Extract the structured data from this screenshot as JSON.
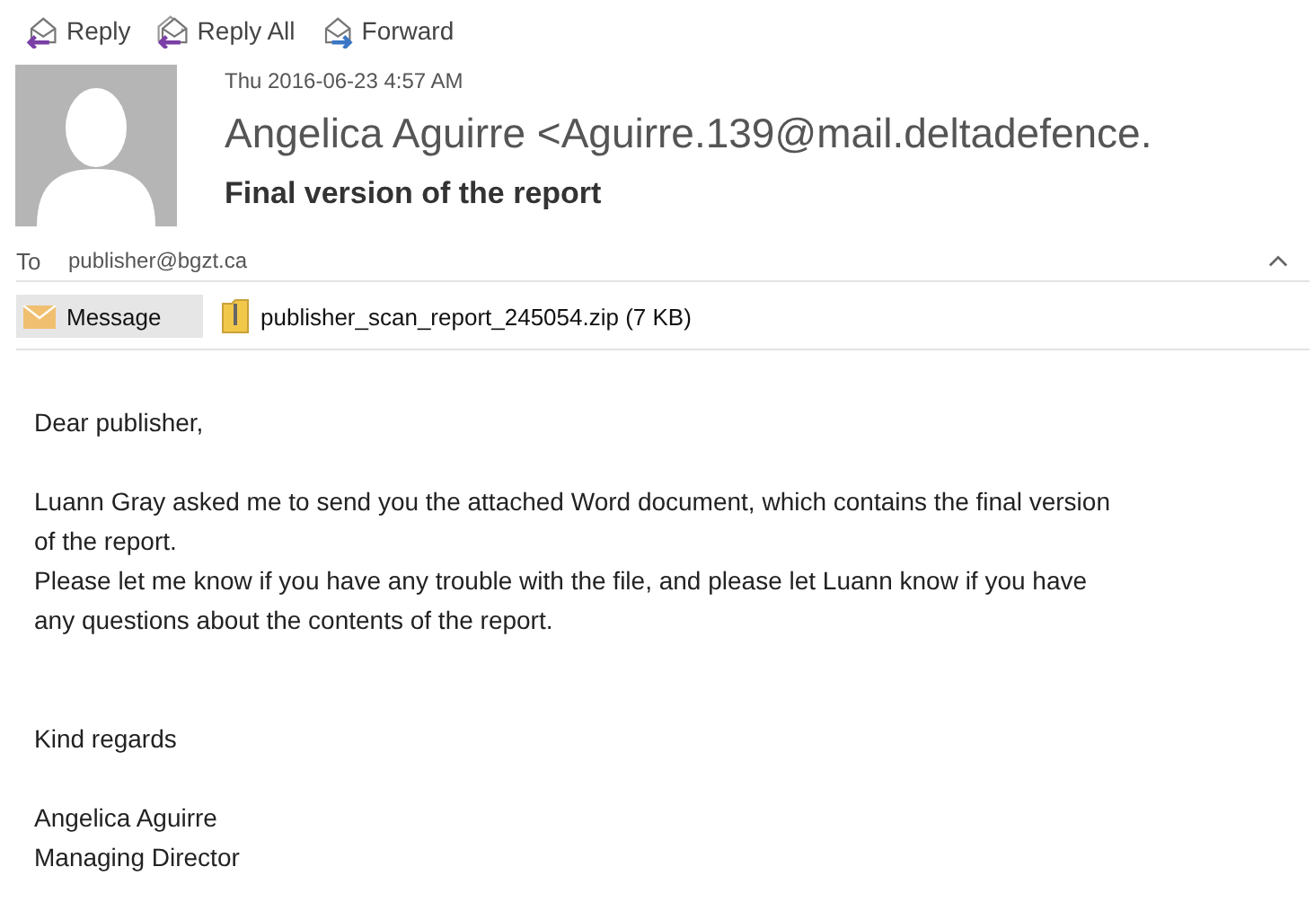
{
  "toolbar": [
    {
      "label": "Reply",
      "kind": "reply"
    },
    {
      "label": "Reply All",
      "kind": "reply-all"
    },
    {
      "label": "Forward",
      "kind": "forward"
    }
  ],
  "header": {
    "date": "Thu 2016-06-23 4:57 AM",
    "sender": "Angelica Aguirre <Aguirre.139@mail.deltadefence.",
    "subject": "Final version of the report",
    "to_label": "To",
    "to": "publisher@bgzt.ca"
  },
  "attachments": [
    {
      "label": "Message",
      "kind": "message",
      "selected": true
    },
    {
      "label": "publisher_scan_report_245054.zip (7 KB)",
      "kind": "zip",
      "selected": false
    }
  ],
  "body": [
    {
      "kind": "greeting",
      "text": "Dear publisher,"
    },
    {
      "kind": "paragraph",
      "text": "Luann Gray asked me to send you the attached Word document, which contains the final version of the report.\nPlease let me know if you have any trouble with the file, and please let Luann know if you have any questions about the contents of the report."
    },
    {
      "kind": "closing",
      "text": "Kind regards"
    },
    {
      "kind": "signature",
      "text": "Angelica Aguirre\nManaging Director"
    }
  ]
}
